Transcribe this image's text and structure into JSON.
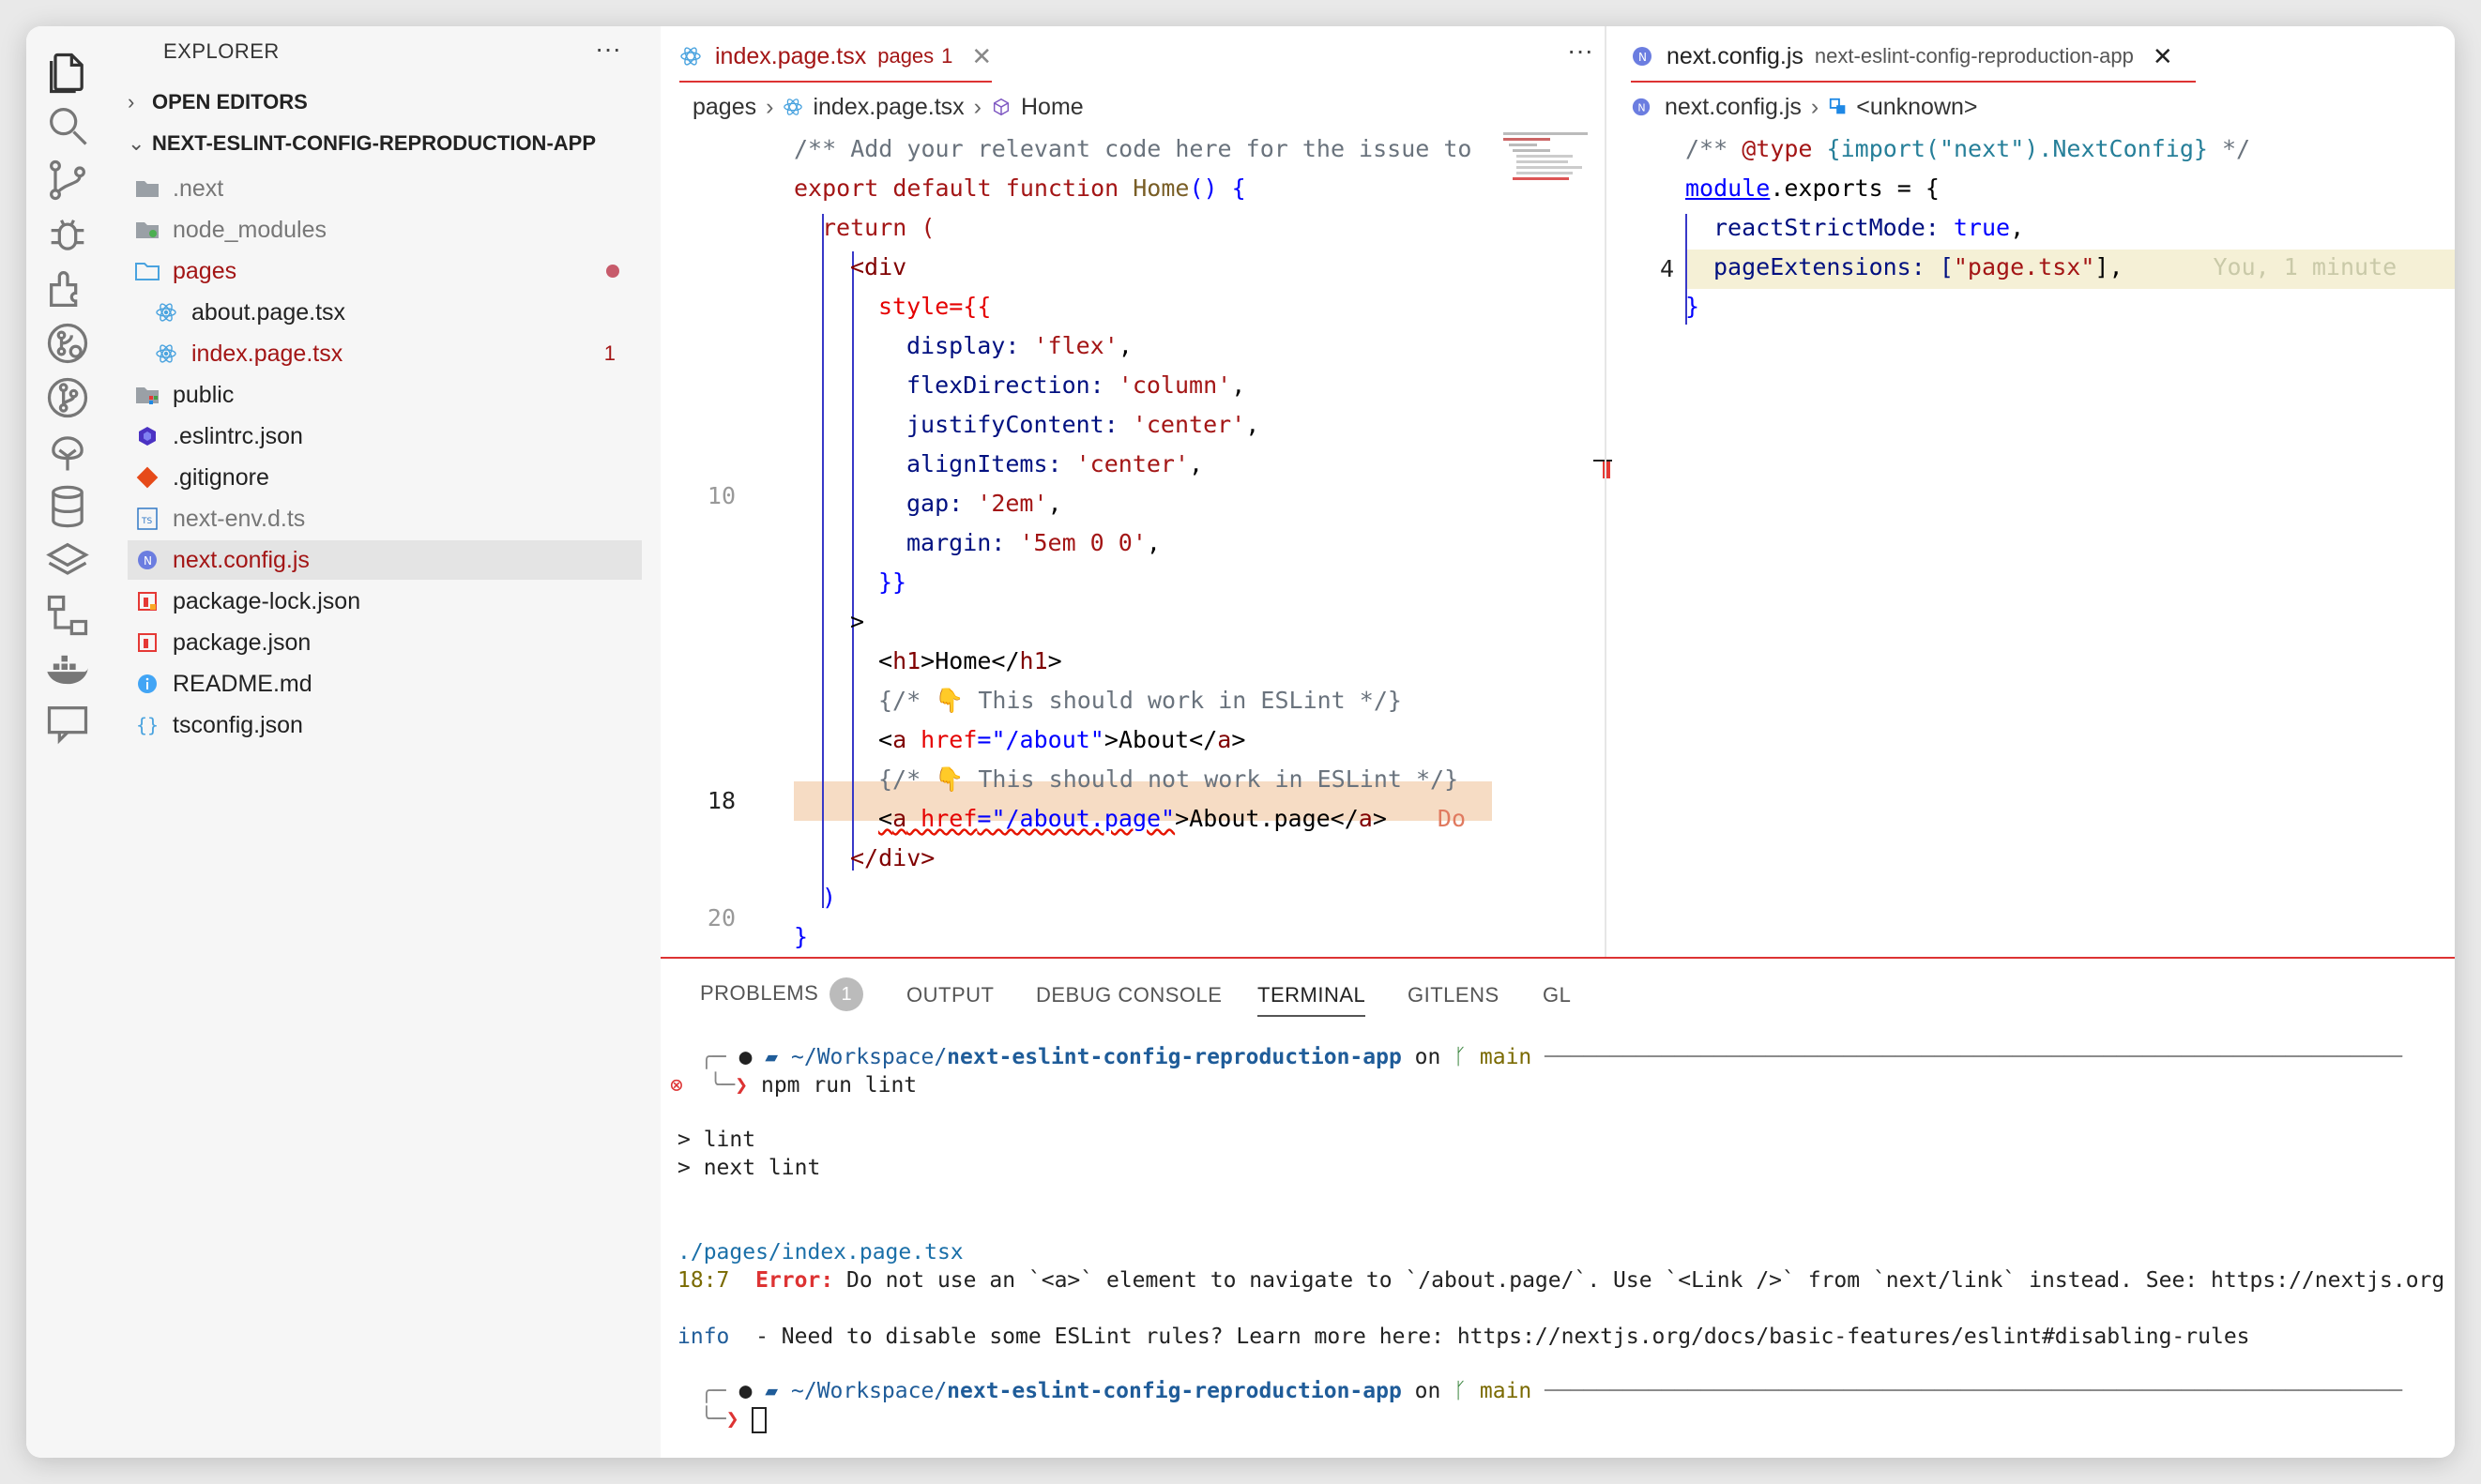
{
  "sidebar": {
    "title": "EXPLORER",
    "more": "···",
    "open_editors": "OPEN EDITORS",
    "project": "NEXT-ESLINT-CONFIG-REPRODUCTION-APP",
    "items": [
      {
        "label": ".next",
        "icon": "folder-icon"
      },
      {
        "label": "node_modules",
        "icon": "folder-node-icon"
      },
      {
        "label": "pages",
        "icon": "folder-open-icon"
      },
      {
        "label": "about.page.tsx",
        "icon": "react-icon"
      },
      {
        "label": "index.page.tsx",
        "icon": "react-icon",
        "count": "1"
      },
      {
        "label": "public",
        "icon": "folder-public-icon"
      },
      {
        "label": ".eslintrc.json",
        "icon": "eslint-icon"
      },
      {
        "label": ".gitignore",
        "icon": "git-icon"
      },
      {
        "label": "next-env.d.ts",
        "icon": "ts-icon"
      },
      {
        "label": "next.config.js",
        "icon": "next-icon"
      },
      {
        "label": "package-lock.json",
        "icon": "npm-icon"
      },
      {
        "label": "package.json",
        "icon": "npm-icon"
      },
      {
        "label": "README.md",
        "icon": "info-icon"
      },
      {
        "label": "tsconfig.json",
        "icon": "json-icon"
      }
    ]
  },
  "editor_left": {
    "tab_label": "index.page.tsx",
    "tab_detail": "pages",
    "tab_count": "1",
    "tab_close": "✕",
    "more": "···",
    "breadcrumb": [
      "pages",
      "index.page.tsx",
      "Home"
    ],
    "line_numbers": {
      "l10": "10",
      "l18": "18",
      "l20": "20"
    },
    "lines": {
      "c1": "/** Add your relevant code here for the issue to",
      "c2_kw": "export default function ",
      "c2_fn": "Home",
      "c2_rest": "() {",
      "c3": "return (",
      "c4": "<div",
      "c5": "style={{",
      "c6_prop": "display: ",
      "c6_str": "'flex'",
      "c7_prop": "flexDirection: ",
      "c7_str": "'column'",
      "c8_prop": "justifyContent: ",
      "c8_str": "'center'",
      "c9_prop": "alignItems: ",
      "c9_str": "'center'",
      "c10_prop": "gap: ",
      "c10_str": "'2em'",
      "c11_prop": "margin: ",
      "c11_str": "'5em 0 0'",
      "c12": "}}",
      "c13": ">",
      "c14_a": "<",
      "c14_tag": "h1",
      "c14_b": ">Home</",
      "c14_c": ">",
      "c15": "{/* 👇 This should work in ESLint */}",
      "c16_a": "<",
      "c16_tag": "a",
      "c16_attr": " href",
      "c16_str": "=\"/about\"",
      "c16_b": ">About</",
      "c16_c": ">",
      "c17": "{/* 👇 This should not work in ESLint */}",
      "c18_a": "<",
      "c18_tag": "a",
      "c18_attr": " href",
      "c18_str": "=\"/about.page\"",
      "c18_b": ">About.page</",
      "c18_c": ">",
      "c18_hint": "Do",
      "c19": "</div>",
      "c20": ")",
      "c21": "}"
    }
  },
  "editor_right": {
    "tab_label": "next.config.js",
    "tab_detail": "next-eslint-config-reproduction-app",
    "tab_close": "✕",
    "breadcrumb": [
      "next.config.js",
      "<unknown>"
    ],
    "line_numbers": {
      "l4": "4"
    },
    "lines": {
      "r1_a": "/** ",
      "r1_b": "@type",
      "r1_c": " {import(\"next\").NextConfig}",
      "r1_d": " */",
      "r2_a": "module",
      "r2_b": ".exports = {",
      "r3_a": "reactStrictMode: ",
      "r3_b": "true",
      "r3_c": ",",
      "r4_a": "pageExtensions: [",
      "r4_b": "\"page.tsx\"",
      "r4_c": "],",
      "r4_blame": "You, 1 minute",
      "r5": "}"
    }
  },
  "panel": {
    "tabs": [
      "PROBLEMS",
      "OUTPUT",
      "DEBUG CONSOLE",
      "TERMINAL",
      "GITLENS",
      "GL"
    ],
    "problems_count": "1",
    "terminal": {
      "prompt_path_a": "~/Workspace/",
      "prompt_path_b": "next-eslint-config-reproduction-app",
      "prompt_on": " on ",
      "prompt_branch": "main",
      "cmd": "npm run lint",
      "out1": "> lint",
      "out2": "> next lint",
      "file": "./pages/index.page.tsx",
      "loc": "18:7",
      "err_label": "Error:",
      "err_msg": " Do not use an `<a>` element to navigate to `/about.page/`. Use `<Link />` from `next/link` instead. See: https://nextjs.org",
      "info_label": "info",
      "info_msg": "  - Need to disable some ESLint rules? Learn more here: https://nextjs.org/docs/basic-features/eslint#disabling-rules"
    }
  },
  "colors": {
    "accent_red": "#a31515",
    "error": "#d33333",
    "keyword_blue": "#0000ff"
  }
}
